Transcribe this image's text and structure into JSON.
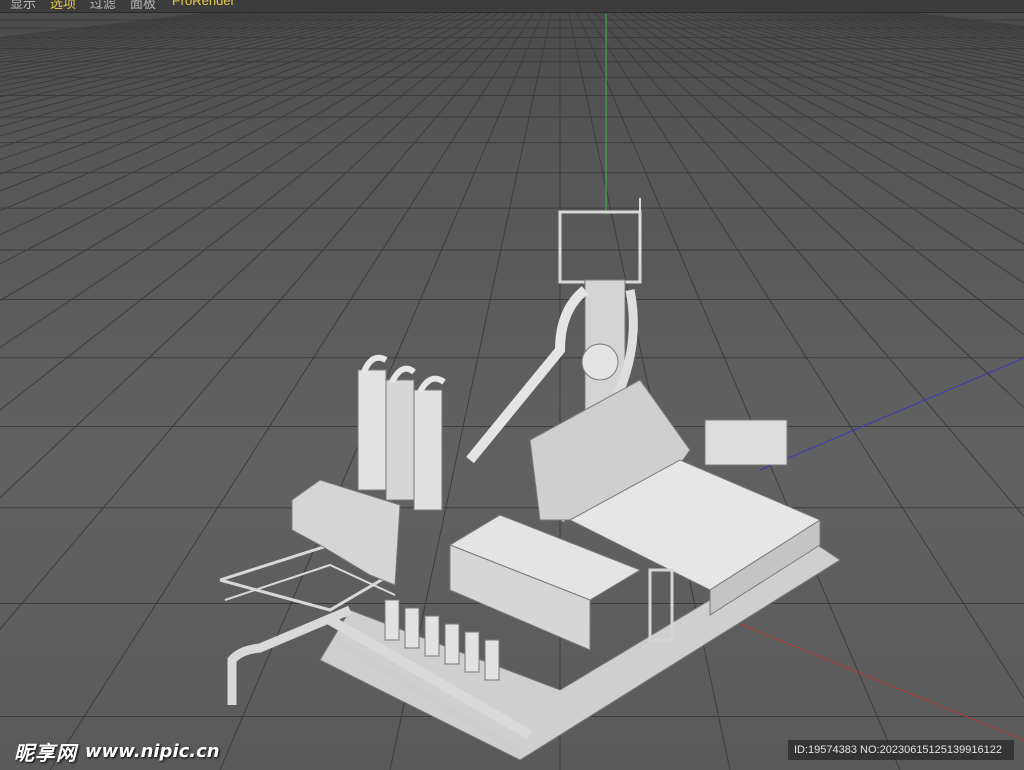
{
  "window": {
    "menu": [
      {
        "label": "显示",
        "state": "normal"
      },
      {
        "label": "选项",
        "state": "active"
      },
      {
        "label": "过滤",
        "state": "normal"
      },
      {
        "label": "面板",
        "state": "normal"
      },
      {
        "label": "ProRender",
        "state": "plugin"
      }
    ]
  },
  "viewport": {
    "mode": "perspective",
    "background_color": "#5e5e5e",
    "grid_color": "#3a3a3a",
    "axis_colors": {
      "x": "#b03a3a",
      "y": "#3fa83f",
      "z": "#3a3ab8"
    },
    "model": "steel blast furnace plant (white clay shading)"
  },
  "watermark": {
    "brand": "昵享网",
    "url": "www.nipic.cn",
    "image_id": "ID:19574383 NO:20230615125139916122"
  }
}
